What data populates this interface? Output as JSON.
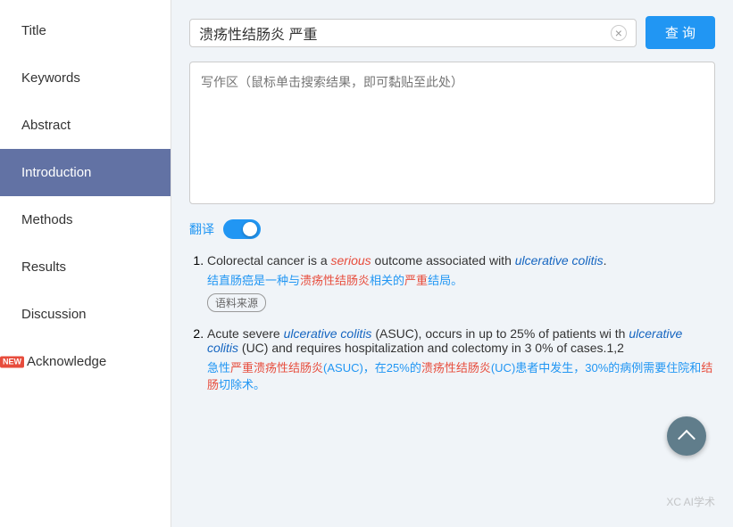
{
  "sidebar": {
    "items": [
      {
        "id": "title",
        "label": "Title",
        "active": false
      },
      {
        "id": "keywords",
        "label": "Keywords",
        "active": false
      },
      {
        "id": "abstract",
        "label": "Abstract",
        "active": false
      },
      {
        "id": "introduction",
        "label": "Introduction",
        "active": true
      },
      {
        "id": "methods",
        "label": "Methods",
        "active": false
      },
      {
        "id": "results",
        "label": "Results",
        "active": false
      },
      {
        "id": "discussion",
        "label": "Discussion",
        "active": false
      },
      {
        "id": "acknowledge",
        "label": "Acknowledge",
        "active": false,
        "badge": "NEW"
      }
    ]
  },
  "search": {
    "value": "溃疡性结肠炎 严重",
    "placeholder": "写作区（鼠标单击搜索结果，即可黏贴至此处）",
    "clear_label": "×",
    "button_label": "查 询"
  },
  "writing_area": {
    "placeholder": "写作区（鼠标单击搜索结果，即可黏贴至此处）"
  },
  "translate": {
    "label": "翻译"
  },
  "results": [
    {
      "number": 1,
      "en_parts": [
        {
          "text": "Colorectal cancer is a ",
          "style": "normal"
        },
        {
          "text": "serious",
          "style": "red-italic"
        },
        {
          "text": " outcome associated with ",
          "style": "normal"
        },
        {
          "text": "ulcerative colitis",
          "style": "blue-italic"
        },
        {
          "text": ".",
          "style": "normal"
        }
      ],
      "zh": "结直肠癌是一种与溃疡性结肠炎相关的严重结局。",
      "source_tag": "语料来源",
      "zh_highlights": [
        {
          "text": "结直肠癌是一种与",
          "style": "blue"
        },
        {
          "text": "溃疡性结肠炎",
          "style": "red"
        },
        {
          "text": "相关的",
          "style": "blue"
        },
        {
          "text": "严重",
          "style": "red"
        },
        {
          "text": "结局。",
          "style": "blue"
        }
      ]
    },
    {
      "number": 2,
      "en_parts": [
        {
          "text": "Acute severe ",
          "style": "normal"
        },
        {
          "text": "ulcerative colitis",
          "style": "blue-italic"
        },
        {
          "text": " (ASUC), occurs in up to 25% of patients wi th ",
          "style": "normal"
        },
        {
          "text": "ulcerative colitis",
          "style": "blue-italic"
        },
        {
          "text": " (UC) and requires hospitalization and colectomy in 3 0% of cases.1,2",
          "style": "normal"
        }
      ],
      "zh_highlights": [
        {
          "text": "急性",
          "style": "blue"
        },
        {
          "text": "严重溃疡性结肠炎",
          "style": "red"
        },
        {
          "text": "(ASUC)，在25%的",
          "style": "blue"
        },
        {
          "text": "溃疡性结肠炎",
          "style": "red"
        },
        {
          "text": "(UC)患者中发生，30%的病例需要住院和",
          "style": "blue"
        },
        {
          "text": "结肠",
          "style": "red"
        },
        {
          "text": "切除术。",
          "style": "blue"
        }
      ]
    }
  ],
  "watermark": {
    "text": "XC AI学术"
  }
}
